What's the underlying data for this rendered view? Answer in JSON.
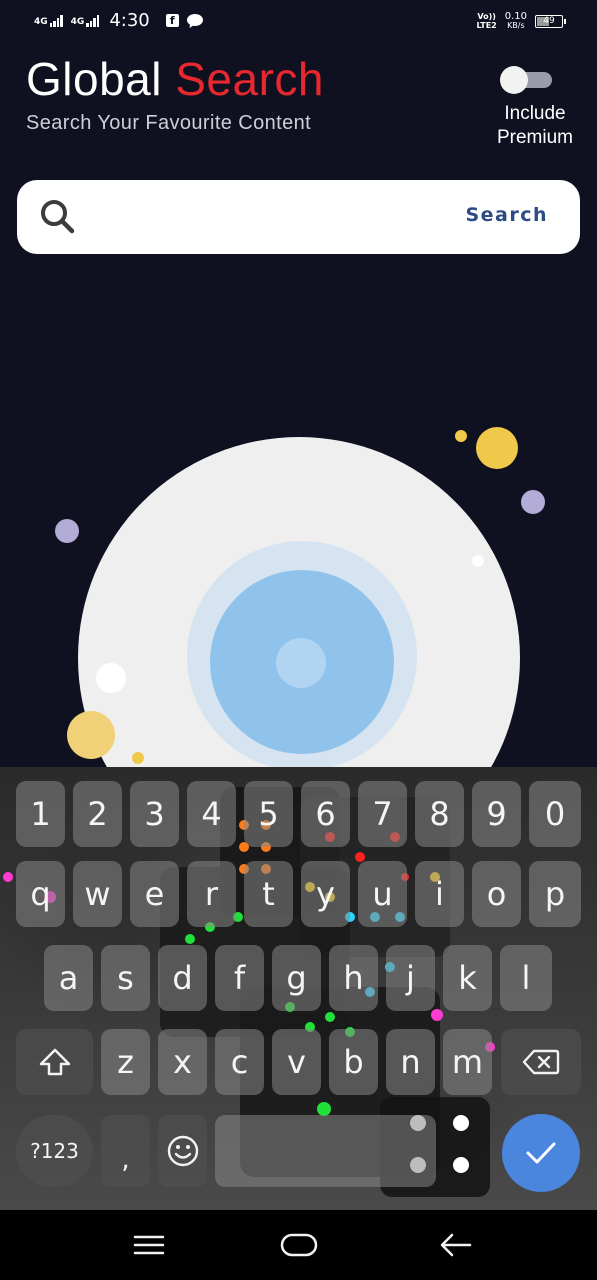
{
  "status_bar": {
    "network1": "4G",
    "network2": "4G",
    "time": "4:30",
    "volte_top": "Vo))",
    "volte_bottom": "LTE2",
    "speed_value": "0.10",
    "speed_unit": "KB/s",
    "battery": "49",
    "battery_level": 0.49,
    "notification_icons": [
      "facebook-icon",
      "chat-bubble-icon"
    ]
  },
  "header": {
    "title_part1": "Global ",
    "title_part2": "Search",
    "subtitle": "Search Your Favourite Content",
    "toggle_label_line1": "Include",
    "toggle_label_line2": "Premium",
    "toggle_state": "off"
  },
  "search": {
    "icon": "search-icon",
    "value": "",
    "button_label": "Search"
  },
  "keyboard": {
    "numbers": [
      "1",
      "2",
      "3",
      "4",
      "5",
      "6",
      "7",
      "8",
      "9",
      "0"
    ],
    "row1": [
      "q",
      "w",
      "e",
      "r",
      "t",
      "y",
      "u",
      "i",
      "o",
      "p"
    ],
    "row2": [
      "a",
      "s",
      "d",
      "f",
      "g",
      "h",
      "j",
      "k",
      "l"
    ],
    "row3": [
      "z",
      "x",
      "c",
      "v",
      "b",
      "n",
      "m"
    ],
    "symbols_key": "?123",
    "comma_key": ",",
    "enter_icon": "checkmark-icon",
    "shift_icon": "shift-icon",
    "backspace_icon": "backspace-icon",
    "emoji_icon": "emoji-icon"
  },
  "colors": {
    "background": "#0f1020",
    "accent_red": "#e8282f",
    "search_button": "#2c4b86",
    "enter_key": "#4b86de"
  },
  "navbar": {
    "icons": [
      "menu-icon",
      "home-icon",
      "back-icon"
    ]
  }
}
